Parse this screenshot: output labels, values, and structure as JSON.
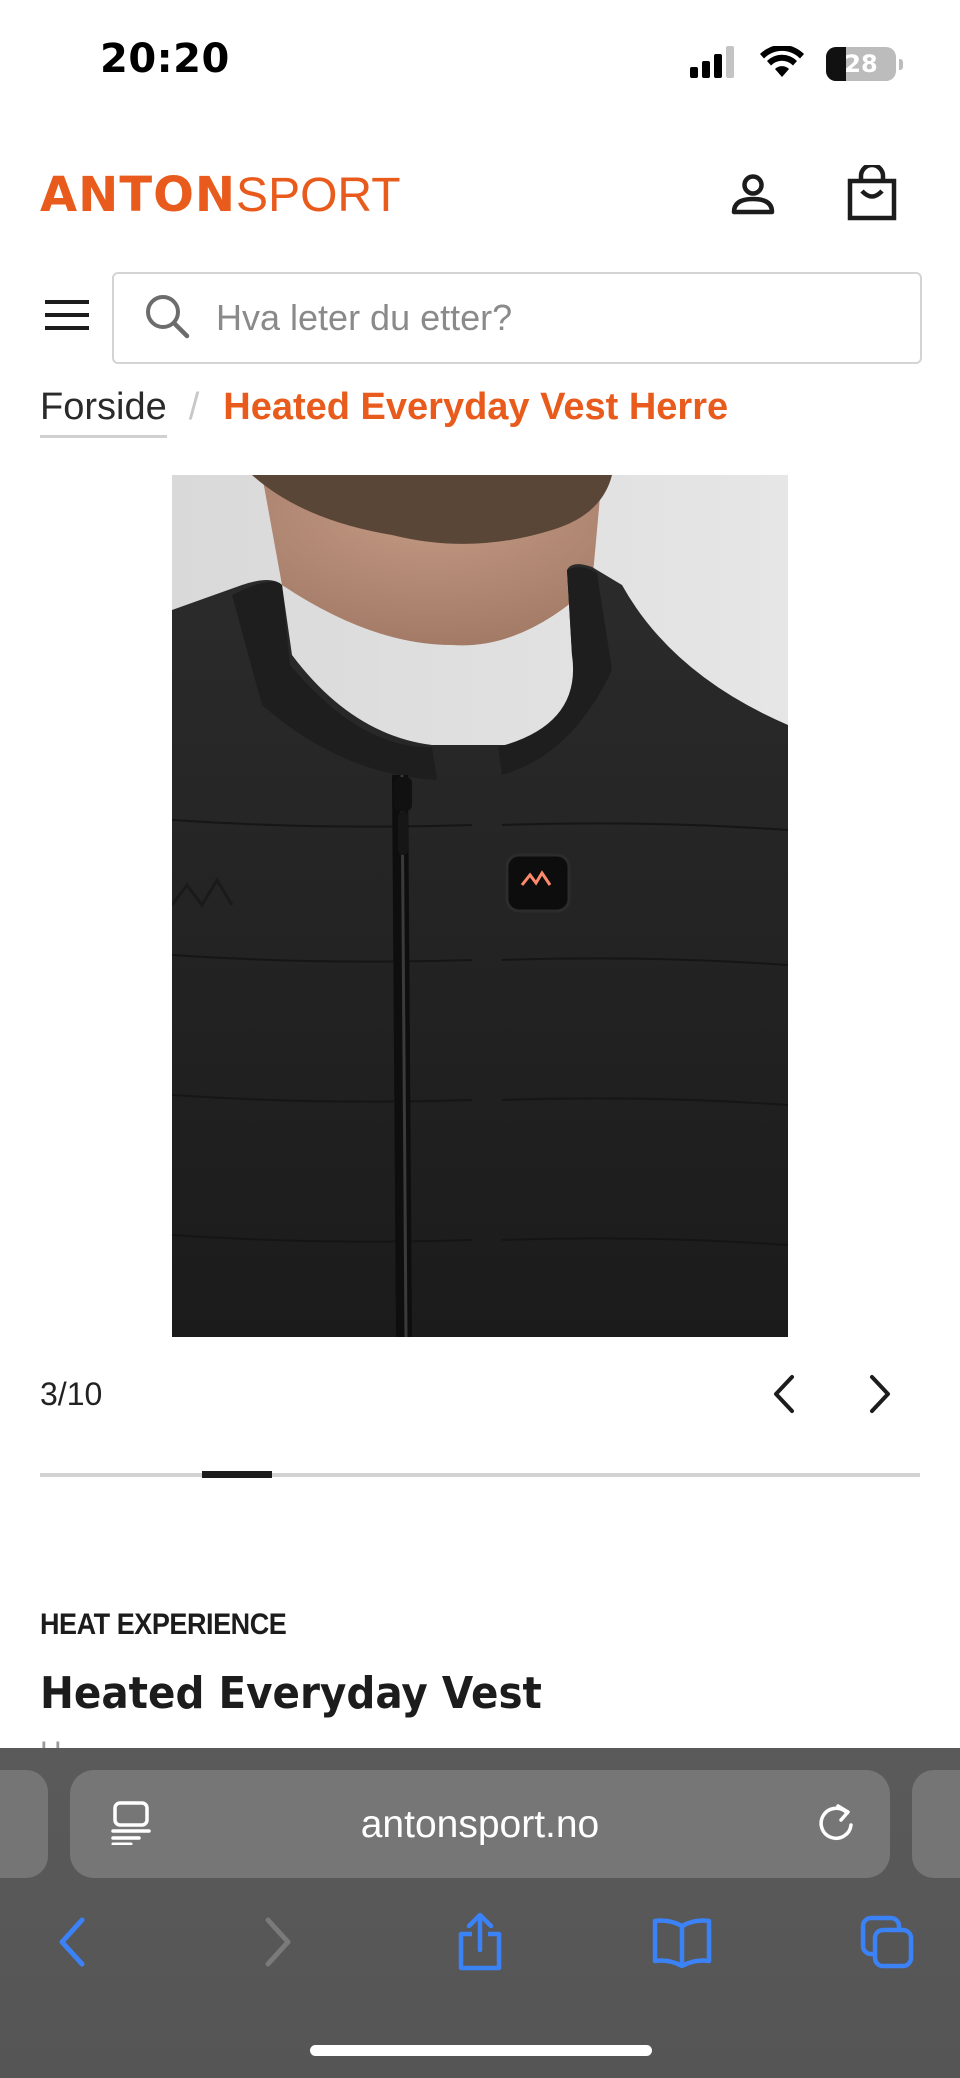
{
  "status_bar": {
    "time": "20:20",
    "battery_level": "28",
    "battery_fraction": 0.28,
    "signal_icon": "cellular-signal-icon",
    "wifi_icon": "wifi-icon"
  },
  "header": {
    "logo_bold": "ANTON",
    "logo_light": "SPORT",
    "brand_color": "#e95b1c",
    "account_icon": "user-icon",
    "cart_icon": "shopping-bag-icon",
    "menu_icon": "hamburger-menu-icon"
  },
  "search": {
    "placeholder": "Hva leter du etter?",
    "icon": "search-icon"
  },
  "breadcrumb": {
    "home": "Forside",
    "separator": "/",
    "current": "Heated Everyday Vest Herre"
  },
  "gallery": {
    "counter": "3/10",
    "current_index": 3,
    "total": 10,
    "prev_icon": "chevron-left-icon",
    "next_icon": "chevron-right-icon"
  },
  "product": {
    "brand": "HEAT EXPERIENCE",
    "title": "Heated Everyday Vest",
    "subtitle": "H"
  },
  "browser": {
    "url": "antonsport.no",
    "reader_icon": "reader-mode-icon",
    "reload_icon": "reload-icon",
    "toolbar": [
      {
        "icon": "back-arrow-icon",
        "enabled": true
      },
      {
        "icon": "forward-arrow-icon",
        "enabled": false
      },
      {
        "icon": "share-icon",
        "enabled": true
      },
      {
        "icon": "bookmarks-icon",
        "enabled": true
      },
      {
        "icon": "tabs-icon",
        "enabled": true
      }
    ],
    "accent_color": "#3b82f6"
  }
}
